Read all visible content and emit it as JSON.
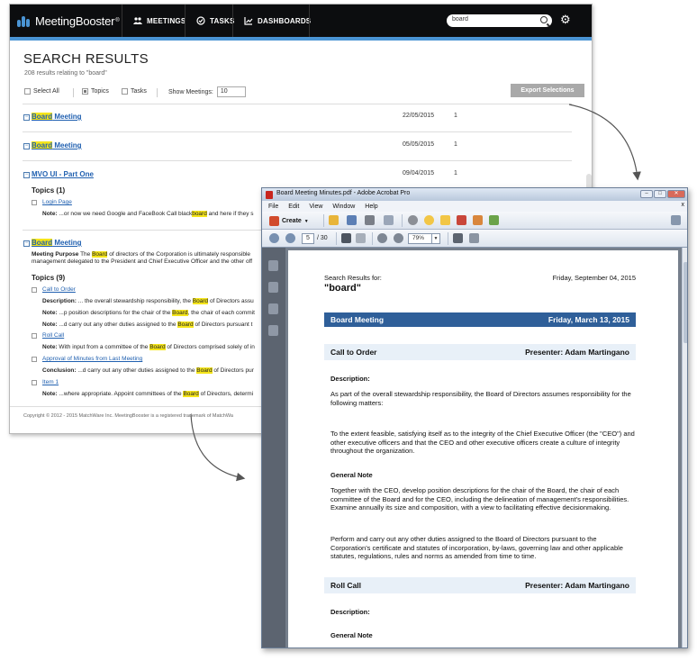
{
  "meetingbooster": {
    "brand": "MeetingBooster",
    "brand_tm": "®",
    "nav": {
      "meetings": "MEETINGS",
      "tasks": "TASKS",
      "dashboards": "DASHBOARDS"
    },
    "search_value": "board",
    "title": "SEARCH RESULTS",
    "result_count": "208 results relating to \"board\"",
    "filters": {
      "select_all": "Select All",
      "topics": "Topics",
      "tasks": "Tasks",
      "show_meetings_label": "Show Meetings:",
      "show_meetings_value": "10"
    },
    "export_button": "Export Selections",
    "results": [
      {
        "hl": "Board",
        "rest": " Meeting",
        "date": "22/05/2015",
        "count": "1"
      },
      {
        "hl": "Board",
        "rest": " Meeting",
        "date": "05/05/2015",
        "count": "1"
      },
      {
        "hl": "",
        "rest": "MVO UI - Part One",
        "date": "09/04/2015",
        "count": "1"
      },
      {
        "hl": "Board",
        "rest": " Meeting",
        "date": "",
        "count": ""
      }
    ],
    "topics_one": "Topics (1)",
    "login_page": "Login Page",
    "note_login_label": "Note:",
    "note_login_pre": " ...or now we need Google and FaceBook Call black",
    "note_login_hl": "board",
    "note_login_post": " and here if they s",
    "meeting_purpose_label": "Meeting Purpose",
    "meeting_purpose_1": " The ",
    "meeting_purpose_hl": "Board",
    "meeting_purpose_2": " of directors of the Corporation is ultimately responsible",
    "meeting_purpose_3": "management delegated to the President and Chief Executive Officer and the other off",
    "topics_nine": "Topics (9)",
    "call_to_order": "Call to Order",
    "desc_label": "Description:",
    "desc_pre": " ... the overall stewardship responsibility, the ",
    "desc_hl": "Board",
    "desc_post": " of Directors assu",
    "note1_label": "Note:",
    "note1_pre": " ...p position descriptions for the chair of the ",
    "note1_hl": "Board",
    "note1_post": ", the chair of each commit",
    "note2_label": "Note:",
    "note2_pre": " ...d carry out any other duties assigned to the ",
    "note2_hl": "Board",
    "note2_post": " of Directors pursuant t",
    "roll_call": "Roll Call",
    "note3_label": "Note:",
    "note3_pre": " With input from a committee of the ",
    "note3_hl": "Board",
    "note3_post": " of Directors comprised solely of in",
    "approval": "Approval of Minutes from Last Meeting",
    "conclusion_label": "Conclusion:",
    "conclusion_pre": " ...d carry out any other duties assigned to the ",
    "conclusion_hl": "Board",
    "conclusion_post": " of Directors pur",
    "item1": "Item 1",
    "note4_label": "Note:",
    "note4_pre": " ...where appropriate. Appoint committees of the ",
    "note4_hl": "Board",
    "note4_post": " of Directors, determi",
    "footer": "Copyright © 2012 - 2015 MatchWare Inc. MeetingBooster is a registered trademark of MatchWa"
  },
  "acrobat": {
    "title": "Board Meeting Minutes.pdf - Adobe Acrobat Pro",
    "menu": [
      "File",
      "Edit",
      "View",
      "Window",
      "Help"
    ],
    "menu_close": "x",
    "create_label": "Create",
    "page_current": "5",
    "page_total": "/ 30",
    "zoom": "79%",
    "doc": {
      "search_results_for": "Search Results for:",
      "query": "\"board\"",
      "export_date": "Friday, September 04, 2015",
      "meeting_title": "Board Meeting",
      "meeting_date": "Friday, March 13, 2015",
      "topic1_title": "Call to Order",
      "topic1_presenter": "Presenter: Adam Martingano",
      "description_heading": "Description:",
      "desc_p1": "As part of the overall stewardship responsibility, the Board of Directors assumes responsibility for the following matters:",
      "desc_p2": "To the extent feasible, satisfying itself as to the integrity of the Chief Executive Officer (the \"CEO\") and other executive officers and that the CEO and other executive officers create a culture of integrity throughout the organization.",
      "general_note_heading": "General Note",
      "note_p1": "Together with the CEO, develop position descriptions for the chair of the Board, the chair of each committee of the Board and for the CEO, including the delineation of management's responsibilities. Examine annually its size and composition, with a view to facilitating effective decisionmaking.",
      "note_p2": "Perform and carry out any other duties assigned to the Board of Directors pursuant to the Corporation's certificate and statutes of incorporation, by-laws, governing law and other applicable statutes, regulations, rules and norms as amended from time to time.",
      "topic2_title": "Roll Call",
      "topic2_presenter": "Presenter: Adam Martingano",
      "description_heading_2": "Description:",
      "general_note_heading_2": "General Note"
    }
  },
  "colors": {
    "nav_bg": "#0c0d0f",
    "accent_blue": "#4a94d4",
    "link_blue": "#2060b0",
    "highlight": "#f5e51b",
    "pdf_header_bar": "#2f5f99",
    "pdf_topic_bar": "#e8f0f8"
  }
}
